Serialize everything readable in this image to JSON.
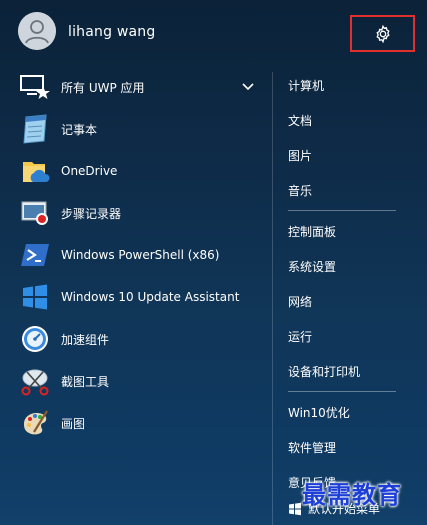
{
  "user": {
    "name": "lihang wang"
  },
  "apps": [
    {
      "label": "所有 UWP 应用",
      "icon": "uwp-apps-icon",
      "expandable": true
    },
    {
      "label": "记事本",
      "icon": "notepad-icon"
    },
    {
      "label": "OneDrive",
      "icon": "onedrive-icon"
    },
    {
      "label": "步骤记录器",
      "icon": "steps-recorder-icon"
    },
    {
      "label": "Windows PowerShell (x86)",
      "icon": "powershell-icon"
    },
    {
      "label": "Windows 10 Update Assistant",
      "icon": "windows-logo-icon"
    },
    {
      "label": "加速组件",
      "icon": "accelerate-icon"
    },
    {
      "label": "截图工具",
      "icon": "snipping-tool-icon"
    },
    {
      "label": "画图",
      "icon": "paint-icon"
    }
  ],
  "right_menu": {
    "group1": [
      "计算机",
      "文档",
      "图片",
      "音乐"
    ],
    "group2": [
      "控制面板",
      "系统设置",
      "网络",
      "运行",
      "设备和打印机"
    ],
    "group3": [
      "Win10优化",
      "软件管理",
      "意见反馈"
    ],
    "last": "默认开始菜单"
  },
  "watermark": "最需教育",
  "colors": {
    "highlight": "#e0302d",
    "watermark": "#1e3fd6"
  }
}
